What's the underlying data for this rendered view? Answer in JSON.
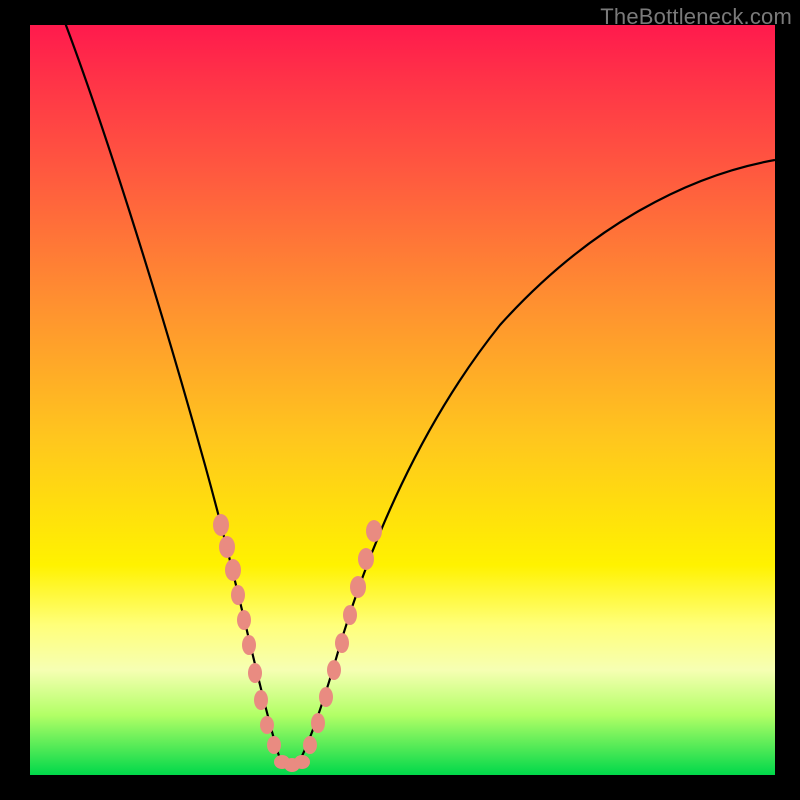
{
  "watermark": "TheBottleneck.com",
  "chart_data": {
    "type": "line",
    "title": "",
    "xlabel": "",
    "ylabel": "",
    "xlim": [
      0,
      100
    ],
    "ylim": [
      0,
      100
    ],
    "grid": false,
    "legend": false,
    "series": [
      {
        "name": "curve",
        "x": [
          5,
          8,
          12,
          16,
          20,
          23,
          26,
          28,
          30,
          32,
          33,
          34,
          36,
          38,
          40,
          44,
          48,
          54,
          60,
          68,
          76,
          84,
          92,
          100
        ],
        "y": [
          100,
          88,
          74,
          60,
          46,
          34,
          24,
          16,
          9,
          4,
          1,
          1,
          4,
          10,
          18,
          30,
          40,
          50,
          58,
          65,
          71,
          75,
          78,
          80
        ]
      }
    ],
    "scatter_overlay": {
      "name": "dots",
      "points": [
        {
          "x": 25.5,
          "y": 30
        },
        {
          "x": 26.5,
          "y": 26
        },
        {
          "x": 27.5,
          "y": 22
        },
        {
          "x": 28.0,
          "y": 19
        },
        {
          "x": 28.8,
          "y": 15
        },
        {
          "x": 29.5,
          "y": 12
        },
        {
          "x": 30.2,
          "y": 9
        },
        {
          "x": 31.0,
          "y": 6
        },
        {
          "x": 31.8,
          "y": 3.5
        },
        {
          "x": 32.6,
          "y": 1.8
        },
        {
          "x": 33.4,
          "y": 0.8
        },
        {
          "x": 34.2,
          "y": 0.8
        },
        {
          "x": 35.0,
          "y": 1.8
        },
        {
          "x": 35.8,
          "y": 3.5
        },
        {
          "x": 36.6,
          "y": 6
        },
        {
          "x": 37.5,
          "y": 9
        },
        {
          "x": 38.5,
          "y": 13
        },
        {
          "x": 39.5,
          "y": 17
        },
        {
          "x": 40.5,
          "y": 21
        },
        {
          "x": 41.5,
          "y": 25
        },
        {
          "x": 42.5,
          "y": 29
        }
      ]
    },
    "gradient_stops": [
      {
        "pos": 0.0,
        "color": "#ff1a4d"
      },
      {
        "pos": 0.2,
        "color": "#ff5a3f"
      },
      {
        "pos": 0.55,
        "color": "#ffc61e"
      },
      {
        "pos": 0.72,
        "color": "#fff200"
      },
      {
        "pos": 0.92,
        "color": "#b2ff66"
      },
      {
        "pos": 1.0,
        "color": "#00d84a"
      }
    ]
  }
}
